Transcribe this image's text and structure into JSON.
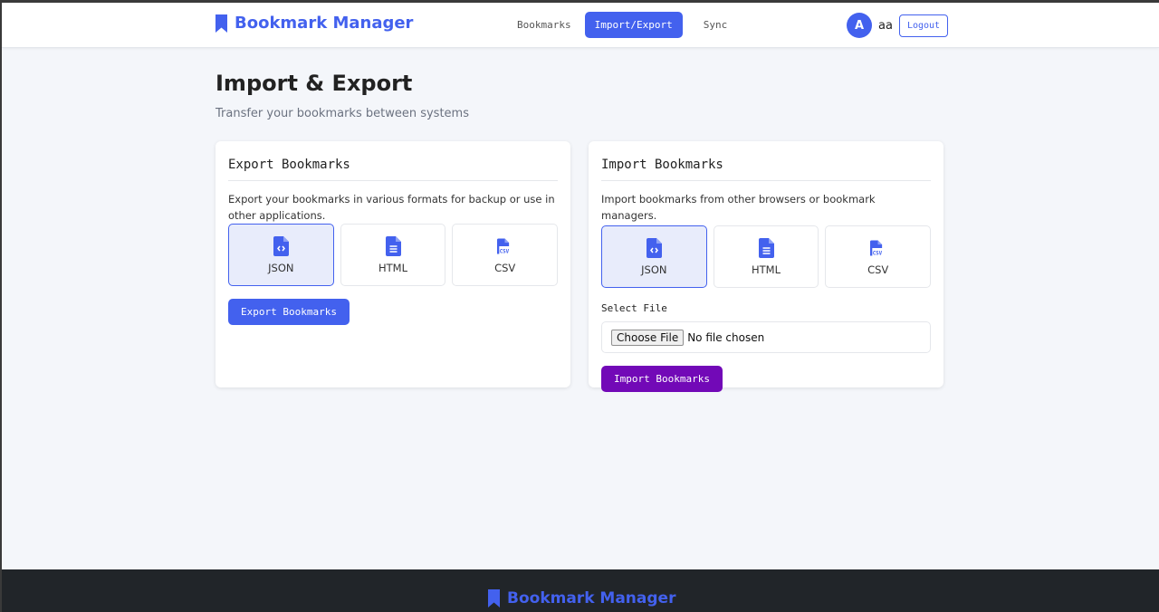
{
  "nav": {
    "brand": "Bookmark Manager",
    "links": [
      "Bookmarks",
      "Import/Export",
      "Sync"
    ],
    "active_link": "Import/Export",
    "user_initial": "A",
    "username": "aa",
    "logout_label": "Logout"
  },
  "page": {
    "title": "Import & Export",
    "subtitle": "Transfer your bookmarks between systems"
  },
  "export": {
    "title": "Export Bookmarks",
    "description": "Export your bookmarks in various formats for backup or use in other applications.",
    "formats": [
      "JSON",
      "HTML",
      "CSV"
    ],
    "selected_format": "JSON",
    "button_label": "Export Bookmarks"
  },
  "import": {
    "title": "Import Bookmarks",
    "description": "Import bookmarks from other browsers or bookmark managers.",
    "formats": [
      "JSON",
      "HTML",
      "CSV"
    ],
    "selected_format": "JSON",
    "file_label": "Select File",
    "choose_file_label": "Choose File",
    "no_file_text": "No file chosen",
    "button_label": "Import Bookmarks"
  },
  "footer": {
    "brand": "Bookmark Manager"
  },
  "colors": {
    "primary": "#4361ee",
    "import_button": "#7209b7",
    "footer_bg": "#212529",
    "page_bg": "#f4f6fa"
  },
  "icons": [
    "bookmark-icon",
    "file-code-icon",
    "file-text-icon",
    "file-csv-icon"
  ]
}
